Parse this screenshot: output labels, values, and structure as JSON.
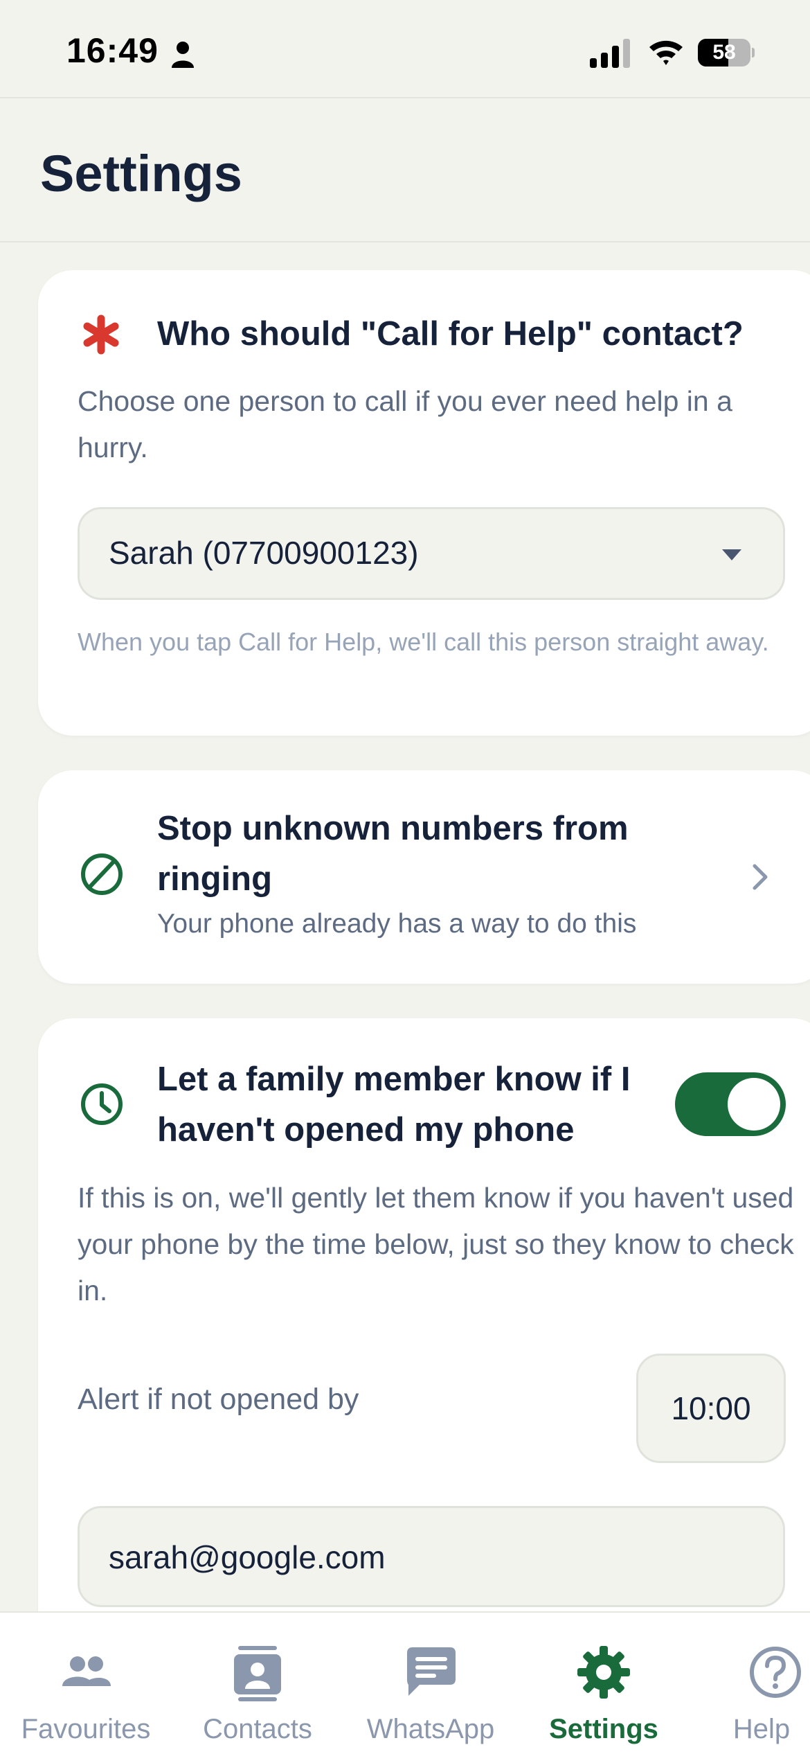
{
  "status_bar": {
    "time": "16:49",
    "battery": "58"
  },
  "header": {
    "title": "Settings"
  },
  "call_for_help": {
    "title": "Who should \"Call for Help\" contact?",
    "description": "Choose one person to call if you ever need help in a hurry.",
    "selected_contact": "Sarah (07700900123)",
    "hint": "When you tap Call for Help, we'll call this person straight away.",
    "icon": "asterisk-icon"
  },
  "unknown_numbers": {
    "title": "Stop unknown numbers from ringing",
    "subtitle": "Your phone already has a way to do this",
    "icon": "block-icon"
  },
  "inactivity_alert": {
    "title": "Let a family member know if I haven't opened my phone",
    "description": "If this is on, we'll gently let them know if you haven't used your phone by the time below, just so they know to check in.",
    "toggle_on": true,
    "alert_label": "Alert if not opened by",
    "alert_time": "10:00",
    "email": "sarah@google.com",
    "icon": "clock-icon"
  },
  "tabs": [
    {
      "label": "Favourites",
      "icon": "people-icon",
      "active": false
    },
    {
      "label": "Contacts",
      "icon": "contact-card-icon",
      "active": false
    },
    {
      "label": "WhatsApp",
      "icon": "chat-bubble-icon",
      "active": false
    },
    {
      "label": "Settings",
      "icon": "gear-icon",
      "active": true
    },
    {
      "label": "Help",
      "icon": "question-icon",
      "active": false
    }
  ],
  "colors": {
    "accent_green": "#1a6b3b",
    "alert_red": "#d8382e",
    "background": "#f3f3ee",
    "muted_text": "#5d6b82",
    "tab_inactive": "#8a97ad"
  }
}
